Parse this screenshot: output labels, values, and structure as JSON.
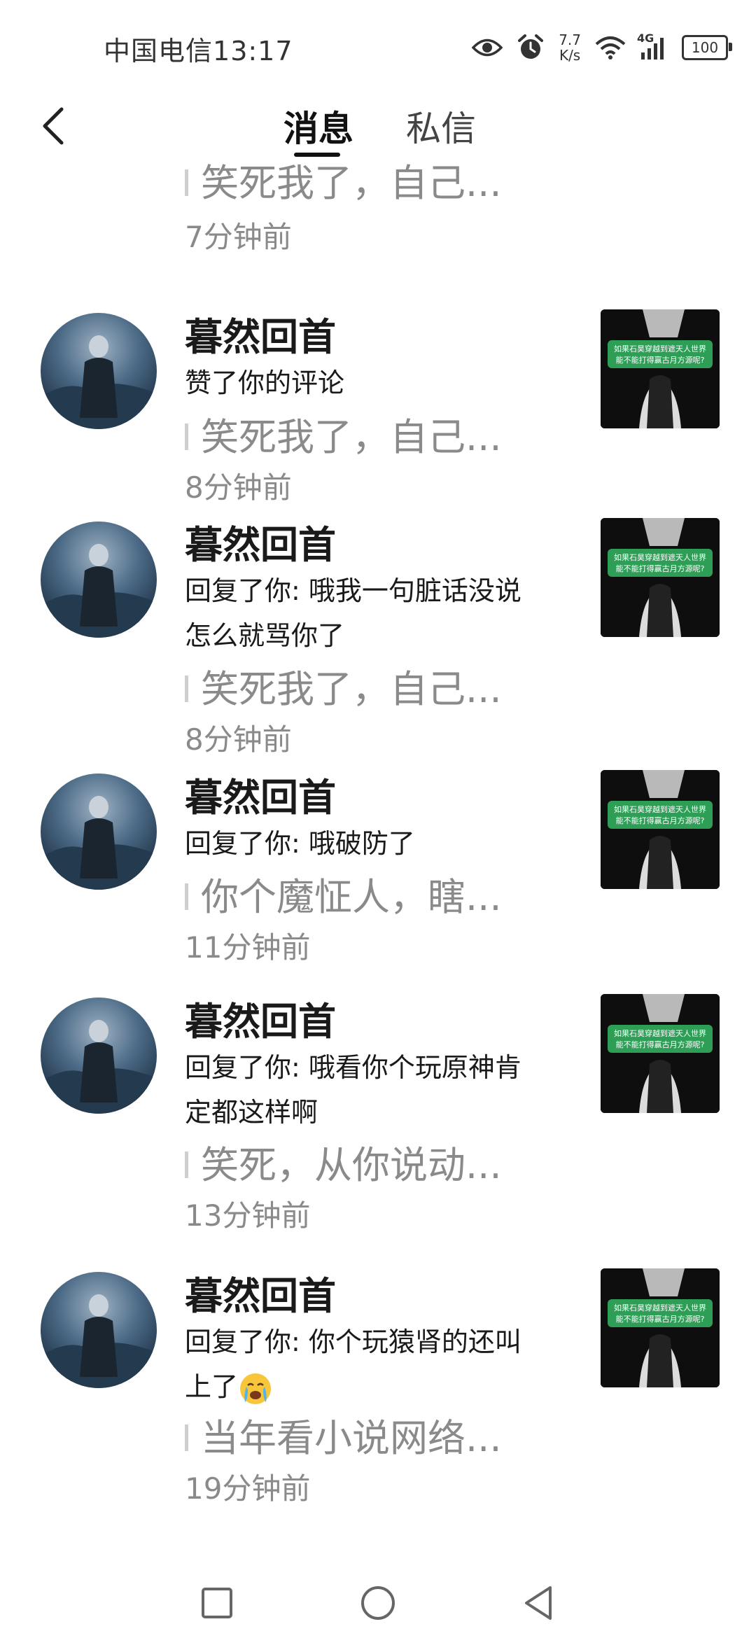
{
  "status_bar": {
    "carrier": "中国电信",
    "time": "13:17",
    "net_speed_value": "7.7",
    "net_speed_unit": "K/s",
    "network": "4G",
    "battery": "100"
  },
  "header": {
    "tabs": [
      {
        "label": "消息",
        "active": true
      },
      {
        "label": "私信",
        "active": false
      }
    ]
  },
  "partial_item": {
    "quote": "笑死我了，自己...",
    "time": "7分钟前"
  },
  "items": [
    {
      "name": "暮然回首",
      "action_lines": [
        "赞了你的评论"
      ],
      "quote": "笑死我了，自己...",
      "time": "8分钟前"
    },
    {
      "name": "暮然回首",
      "action_lines": [
        "回复了你: 哦我一句脏话没说",
        "怎么就骂你了"
      ],
      "quote": "笑死我了，自己...",
      "time": "8分钟前"
    },
    {
      "name": "暮然回首",
      "action_lines": [
        "回复了你: 哦破防了"
      ],
      "quote": "你个魔怔人，瞎...",
      "time": "11分钟前"
    },
    {
      "name": "暮然回首",
      "action_lines": [
        "回复了你: 哦看你个玩原神肯",
        "定都这样啊"
      ],
      "quote": "笑死，从你说动...",
      "time": "13分钟前"
    },
    {
      "name": "暮然回首",
      "action_lines": [
        "回复了你: 你个玩猿肾的还叫",
        "上了"
      ],
      "quote": "当年看小说网络...",
      "time": "19分钟前"
    }
  ],
  "thumbnail_caption_lines": [
    "如果石昊穿越到遮天人世界",
    "能不能打得赢古月方源呢?"
  ],
  "icons": {
    "back": "chevron-left-icon",
    "eye": "eye-icon",
    "alarm": "alarm-icon",
    "wifi": "wifi-icon",
    "signal": "signal-icon",
    "emoji": "crying-face-icon",
    "nav": [
      "square-icon",
      "circle-icon",
      "triangle-back-icon"
    ]
  },
  "colors": {
    "text_primary": "#1a1a1a",
    "text_secondary": "#8a8a8a",
    "thumb_banner": "#2e9e57"
  }
}
